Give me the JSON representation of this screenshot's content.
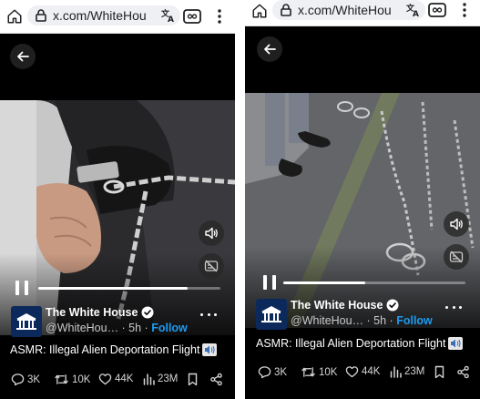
{
  "screens": [
    {
      "url_text": "x.com/WhiteHou",
      "post": {
        "author_name": "The White House",
        "handle_time": "@WhiteHou… · 5h · ",
        "follow_label": "Follow",
        "caption": "ASMR: Illegal Alien Deportation Flight",
        "replies": "3K",
        "reposts": "10K",
        "likes": "44K",
        "views": "23M",
        "progress": 0.82
      }
    },
    {
      "url_text": "x.com/WhiteHou",
      "post": {
        "author_name": "The White House",
        "handle_time": "@WhiteHou… · 5h · ",
        "follow_label": "Follow",
        "caption": "ASMR: Illegal Alien Deportation Flight",
        "replies": "3K",
        "reposts": "10K",
        "likes": "44K",
        "views": "23M",
        "progress": 0.45
      }
    }
  ],
  "colors": {
    "accent": "#1d9bf0",
    "background": "#000000",
    "url_pill": "#eef0f3"
  },
  "icons": [
    "home-icon",
    "lock-icon",
    "translate-icon",
    "tabs-icon",
    "menu-icon",
    "back-arrow-icon",
    "volume-icon",
    "captions-off-icon",
    "pause-icon",
    "verified-icon",
    "more-icon",
    "speaker-icon",
    "reply-icon",
    "repost-icon",
    "like-icon",
    "views-icon",
    "bookmark-icon",
    "share-icon"
  ]
}
